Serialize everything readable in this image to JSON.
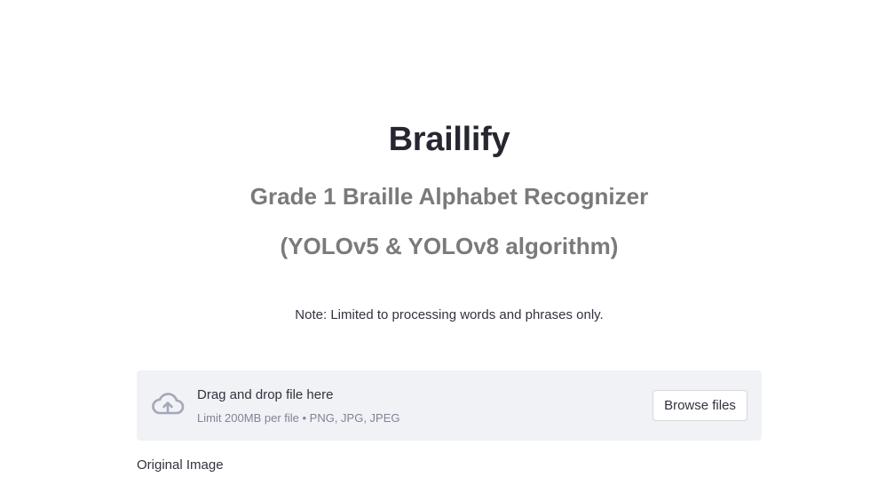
{
  "header": {
    "title": "Braillify",
    "subtitle": "Grade 1 Braille Alphabet Recognizer",
    "subtitle2": "(YOLOv5 & YOLOv8 algorithm)"
  },
  "note": "Note: Limited to processing words and phrases only.",
  "uploader": {
    "drag_text": "Drag and drop file here",
    "limit_text": "Limit 200MB per file • PNG, JPG, JPEG",
    "browse_label": "Browse files",
    "icon": "cloud-upload-icon",
    "background_color": "#f0f2f6"
  },
  "sections": {
    "original_image_label": "Original Image"
  }
}
